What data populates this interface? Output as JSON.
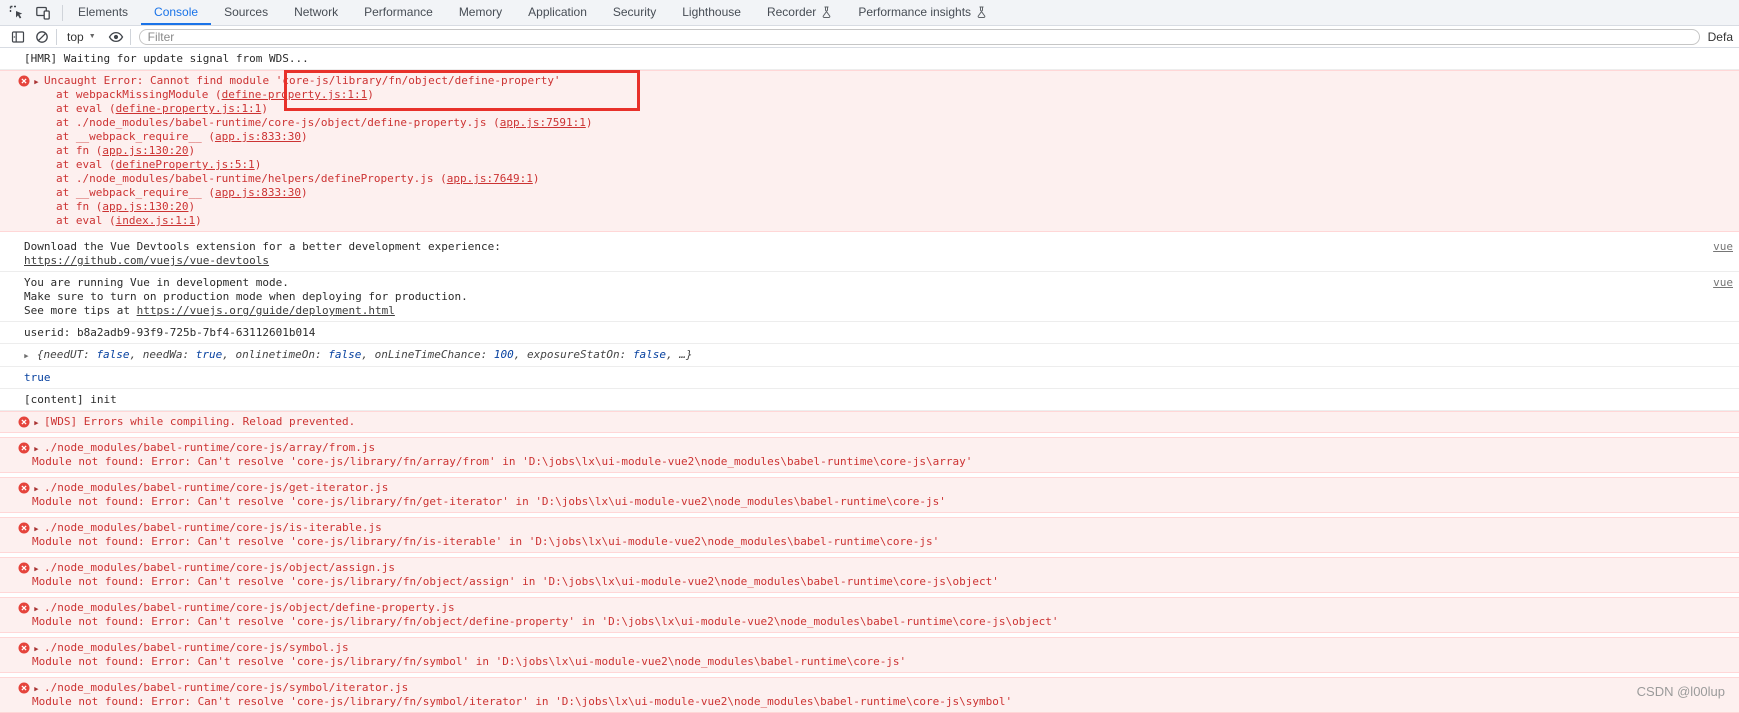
{
  "colors": {
    "accent_blue": "#1a73e8",
    "error_text": "#cc3333",
    "error_bg": "#fdf0ef",
    "error_border": "#ffd7d7",
    "error_badge": "#e5443c",
    "annotation_red": "#e8312a",
    "result_blue": "#0842a0"
  },
  "icons": {
    "inspect": "inspect-cursor-icon",
    "device": "device-toolbar-icon",
    "sidebar": "show-console-sidebar-icon",
    "clear": "clear-console-icon",
    "eye": "create-live-expression-icon",
    "flask": "experiment-flask-icon",
    "error": "error-circle-x-icon",
    "dropdown_caret": "▼",
    "expand_arrow": "▶"
  },
  "tab_bar": {
    "active_tab": "Console",
    "tabs": [
      {
        "label": "Elements"
      },
      {
        "label": "Console"
      },
      {
        "label": "Sources"
      },
      {
        "label": "Network"
      },
      {
        "label": "Performance"
      },
      {
        "label": "Memory"
      },
      {
        "label": "Application"
      },
      {
        "label": "Security"
      },
      {
        "label": "Lighthouse"
      },
      {
        "label": "Recorder"
      },
      {
        "label": "Performance insights"
      }
    ]
  },
  "filter_bar": {
    "context_selector": "top",
    "filter_placeholder": "Filter",
    "levels_label": "Defa"
  },
  "console": {
    "punct_close": ")",
    "hmr": "[HMR] Waiting for update signal from WDS...",
    "uncaught": {
      "message": "Uncaught Error: Cannot find module 'core-js/library/fn/object/define-property'",
      "stack": [
        {
          "pre": "at webpackMissingModule (",
          "link": "define-property.js:1:1"
        },
        {
          "pre": "at eval (",
          "link": "define-property.js:1:1"
        },
        {
          "pre": "at ./node_modules/babel-runtime/core-js/object/define-property.js (",
          "link": "app.js:7591:1"
        },
        {
          "pre": "at __webpack_require__ (",
          "link": "app.js:833:30"
        },
        {
          "pre": "at fn (",
          "link": "app.js:130:20"
        },
        {
          "pre": "at eval (",
          "link": "defineProperty.js:5:1"
        },
        {
          "pre": "at ./node_modules/babel-runtime/helpers/defineProperty.js (",
          "link": "app.js:7649:1"
        },
        {
          "pre": "at __webpack_require__ (",
          "link": "app.js:833:30"
        },
        {
          "pre": "at fn (",
          "link": "app.js:130:20"
        },
        {
          "pre": "at eval (",
          "link": "index.js:1:1"
        }
      ]
    },
    "vue_devtools": {
      "text": "Download the Vue Devtools extension for a better development experience:",
      "link": "https://github.com/vuejs/vue-devtools",
      "source": "vue"
    },
    "vue_mode": {
      "line1": "You are running Vue in development mode.",
      "line2": "Make sure to turn on production mode when deploying for production.",
      "line3_prefix": "See more tips at ",
      "link": "https://vuejs.org/guide/deployment.html",
      "source": "vue"
    },
    "userid": "userid: b8a2adb9-93f9-725b-7bf4-63112601b014",
    "object_preview": {
      "tokens": [
        {
          "t": "{needUT: "
        },
        {
          "t": "false"
        },
        {
          "t": ", needWa: "
        },
        {
          "t": "true"
        },
        {
          "t": ", onlinetimeOn: "
        },
        {
          "t": "false"
        },
        {
          "t": ", onLineTimeChance: "
        },
        {
          "t": "100"
        },
        {
          "t": ", exposureStatOn: "
        },
        {
          "t": "false"
        },
        {
          "t": ", …}"
        }
      ]
    },
    "result_true": "true",
    "content_init": "[content] init",
    "wds": "[WDS] Errors while compiling. Reload prevented.",
    "module_errors": [
      {
        "file": "./node_modules/babel-runtime/core-js/array/from.js",
        "detail": "Module not found: Error: Can't resolve 'core-js/library/fn/array/from' in 'D:\\jobs\\lx\\ui-module-vue2\\node_modules\\babel-runtime\\core-js\\array'"
      },
      {
        "file": "./node_modules/babel-runtime/core-js/get-iterator.js",
        "detail": "Module not found: Error: Can't resolve 'core-js/library/fn/get-iterator' in 'D:\\jobs\\lx\\ui-module-vue2\\node_modules\\babel-runtime\\core-js'"
      },
      {
        "file": "./node_modules/babel-runtime/core-js/is-iterable.js",
        "detail": "Module not found: Error: Can't resolve 'core-js/library/fn/is-iterable' in 'D:\\jobs\\lx\\ui-module-vue2\\node_modules\\babel-runtime\\core-js'"
      },
      {
        "file": "./node_modules/babel-runtime/core-js/object/assign.js",
        "detail": "Module not found: Error: Can't resolve 'core-js/library/fn/object/assign' in 'D:\\jobs\\lx\\ui-module-vue2\\node_modules\\babel-runtime\\core-js\\object'"
      },
      {
        "file": "./node_modules/babel-runtime/core-js/object/define-property.js",
        "detail": "Module not found: Error: Can't resolve 'core-js/library/fn/object/define-property' in 'D:\\jobs\\lx\\ui-module-vue2\\node_modules\\babel-runtime\\core-js\\object'"
      },
      {
        "file": "./node_modules/babel-runtime/core-js/symbol.js",
        "detail": "Module not found: Error: Can't resolve 'core-js/library/fn/symbol' in 'D:\\jobs\\lx\\ui-module-vue2\\node_modules\\babel-runtime\\core-js'"
      },
      {
        "file": "./node_modules/babel-runtime/core-js/symbol/iterator.js",
        "detail": "Module not found: Error: Can't resolve 'core-js/library/fn/symbol/iterator' in 'D:\\jobs\\lx\\ui-module-vue2\\node_modules\\babel-runtime\\core-js\\symbol'"
      }
    ]
  },
  "watermark": "CSDN @l00lup"
}
